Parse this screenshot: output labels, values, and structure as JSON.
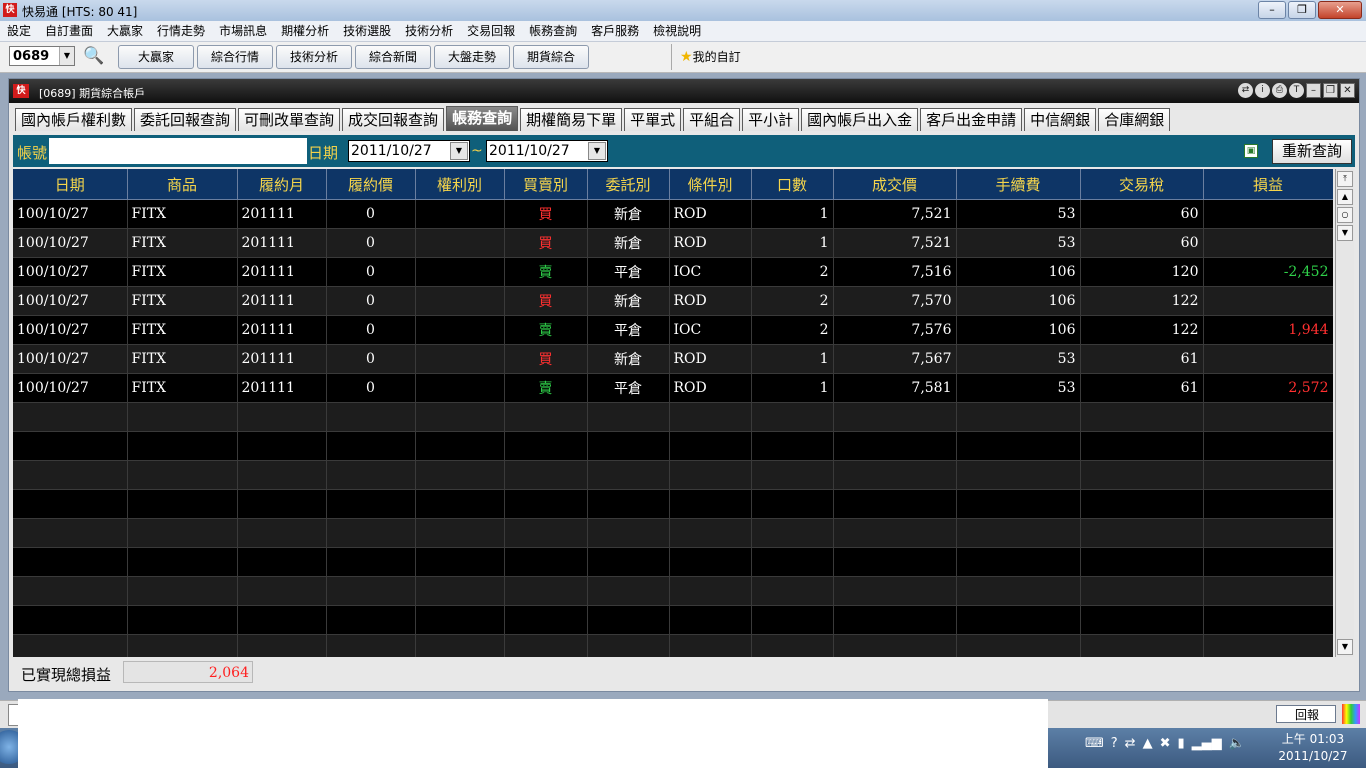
{
  "window": {
    "title": "快易通 [HTS: 80 41]",
    "app_logo": "快"
  },
  "menu": [
    "設定",
    "自訂畫面",
    "大贏家",
    "行情走勢",
    "市場訊息",
    "期權分析",
    "技術選股",
    "技術分析",
    "交易回報",
    "帳務查詢",
    "客戶服務",
    "檢視說明"
  ],
  "toolbar": {
    "code_value": "0689",
    "buttons": [
      "大贏家",
      "綜合行情",
      "技術分析",
      "綜合新聞",
      "大盤走勢",
      "期貨綜合"
    ],
    "favorites_label": "我的自訂"
  },
  "inner": {
    "title": "[0689] 期貨綜合帳戶",
    "tabs": [
      "國內帳戶權利數",
      "委託回報查詢",
      "可刪改單查詢",
      "成交回報查詢",
      "帳務查詢",
      "期權簡易下單",
      "平單式",
      "平組合",
      "平小計",
      "國內帳戶出入金",
      "客戶出金申請",
      "中信網銀",
      "合庫網銀"
    ],
    "active_tab_index": 4
  },
  "filter": {
    "account_label": "帳號",
    "account_value": "",
    "date_label": "日期",
    "date_from": "2011/10/27",
    "date_separator": "~",
    "date_to": "2011/10/27",
    "requery_label": "重新查詢"
  },
  "table": {
    "columns": [
      "日期",
      "商品",
      "履約月",
      "履約價",
      "權利別",
      "買賣別",
      "委託別",
      "條件別",
      "口數",
      "成交價",
      "手續費",
      "交易稅",
      "損益"
    ],
    "rows": [
      [
        "100/10/27",
        "FITX",
        "201111",
        "0",
        "",
        "買",
        "新倉",
        "ROD",
        "1",
        "7,521",
        "53",
        "60",
        ""
      ],
      [
        "100/10/27",
        "FITX",
        "201111",
        "0",
        "",
        "買",
        "新倉",
        "ROD",
        "1",
        "7,521",
        "53",
        "60",
        ""
      ],
      [
        "100/10/27",
        "FITX",
        "201111",
        "0",
        "",
        "賣",
        "平倉",
        "IOC",
        "2",
        "7,516",
        "106",
        "120",
        "-2,452"
      ],
      [
        "100/10/27",
        "FITX",
        "201111",
        "0",
        "",
        "買",
        "新倉",
        "ROD",
        "2",
        "7,570",
        "106",
        "122",
        ""
      ],
      [
        "100/10/27",
        "FITX",
        "201111",
        "0",
        "",
        "賣",
        "平倉",
        "IOC",
        "2",
        "7,576",
        "106",
        "122",
        "1,944"
      ],
      [
        "100/10/27",
        "FITX",
        "201111",
        "0",
        "",
        "買",
        "新倉",
        "ROD",
        "1",
        "7,567",
        "53",
        "61",
        ""
      ],
      [
        "100/10/27",
        "FITX",
        "201111",
        "0",
        "",
        "賣",
        "平倉",
        "ROD",
        "1",
        "7,581",
        "53",
        "61",
        "2,572"
      ]
    ],
    "empty_rows": 9
  },
  "summary": {
    "label": "已實現總損益",
    "value": "2,064"
  },
  "status": {
    "returns_label": "回報"
  },
  "taskbar": {
    "time": "上午 01:03",
    "date": "2011/10/27"
  },
  "colors": {
    "header_bg": "#0e3566",
    "header_text": "#f5d54b",
    "filter_bg": "#0f5f7a",
    "buy": "#ff3030",
    "sell": "#2fd04a"
  }
}
